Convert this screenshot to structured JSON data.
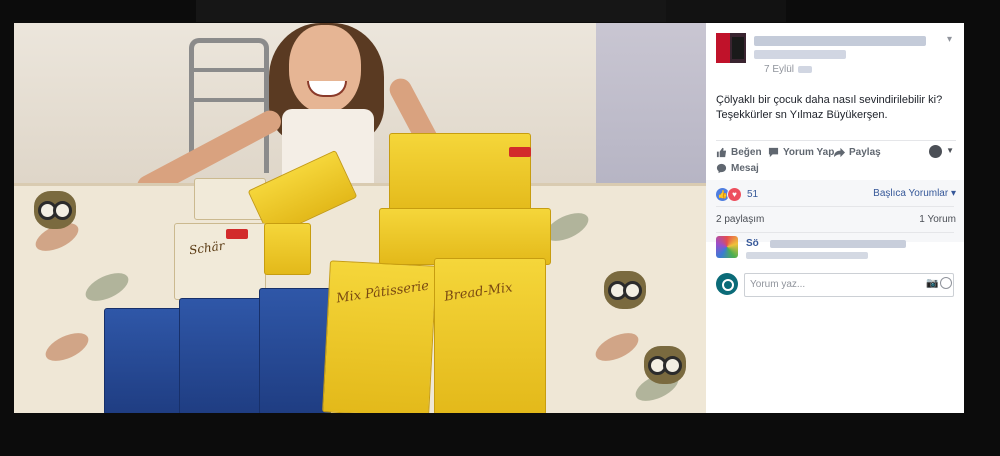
{
  "post": {
    "date": "7 Eylül",
    "text_line1": "Çölyaklı bir çocuk daha nasıl sevindirilebilir ki?",
    "text_line2": "Teşekkürler sn Yılmaz Büyükerşen."
  },
  "actions": {
    "like": "Beğen",
    "comment": "Yorum Yap",
    "share": "Paylaş",
    "message": "Mesaj"
  },
  "reactions": {
    "count": "51",
    "sort_label": "Başlıca Yorumlar ▾",
    "shares": "2 paylaşım",
    "comments": "1 Yorum"
  },
  "comment_box": {
    "placeholder": "Yorum yaz..."
  },
  "photo": {
    "label_patisserie": "Mix Pâtisserie",
    "label_breadmix": "Bread-Mix",
    "label_schar": "Schär"
  },
  "icons": {
    "chevron": "chevron-down-icon",
    "like": "thumbs-up-icon",
    "comment": "comment-icon",
    "share": "share-icon",
    "audience": "globe-icon",
    "camera": "camera-icon",
    "emoji": "emoji-icon"
  },
  "colors": {
    "link": "#365899",
    "like_reaction": "#4f7ee0",
    "love_reaction": "#ed4f5e",
    "background": "#0c0c0c"
  }
}
